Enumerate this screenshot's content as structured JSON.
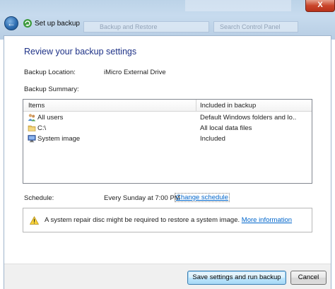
{
  "window": {
    "title": "Set up backup",
    "back_icon": "back-arrow-icon",
    "close_label": "X",
    "ghost_address": "Backup and Restore",
    "ghost_search": "Search Control Panel"
  },
  "page": {
    "heading": "Review your backup settings",
    "backup_location_label": "Backup Location:",
    "backup_location_value": "iMicro External Drive",
    "backup_summary_label": "Backup Summary:"
  },
  "summary_table": {
    "columns": [
      "Items",
      "Included in backup"
    ],
    "rows": [
      {
        "icon": "users-icon",
        "item": "All users",
        "included": "Default Windows folders and lo..."
      },
      {
        "icon": "drive-icon",
        "item": "C:\\",
        "included": "All local data files"
      },
      {
        "icon": "system-image-icon",
        "item": "System image",
        "included": "Included"
      }
    ]
  },
  "schedule": {
    "label": "Schedule:",
    "value": "Every Sunday at 7:00 PM",
    "change_link": "Change schedule"
  },
  "warning": {
    "icon": "warning-icon",
    "text": "A system repair disc might be required to restore a system image.",
    "link": "More information"
  },
  "buttons": {
    "save": "Save settings and run backup",
    "cancel": "Cancel"
  },
  "colors": {
    "heading": "#1e3287",
    "link": "#0066cc",
    "titlebar": "#c7dbee",
    "close": "#c9452b"
  }
}
